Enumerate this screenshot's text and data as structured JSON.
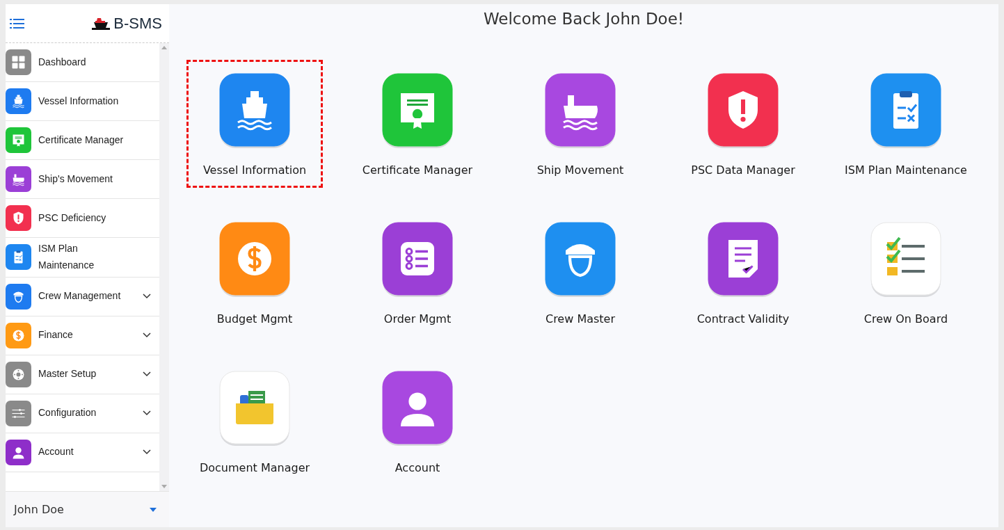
{
  "brand": {
    "name": "B-SMS"
  },
  "sidebar": {
    "items": [
      {
        "label": "Dashboard",
        "color": "#8a8a8a",
        "expandable": false
      },
      {
        "label": "Vessel Information",
        "color": "#1e7bf0",
        "expandable": false
      },
      {
        "label": "Certificate Manager",
        "color": "#1fc53a",
        "expandable": false
      },
      {
        "label": "Ship's Movement",
        "color": "#9b3fd6",
        "expandable": false
      },
      {
        "label": "PSC Deficiency",
        "color": "#f2304f",
        "expandable": false
      },
      {
        "label": "ISM Plan Maintenance",
        "color": "#1e86f0",
        "expandable": false
      },
      {
        "label": "Crew Management",
        "color": "#1e7bf0",
        "expandable": true
      },
      {
        "label": "Finance",
        "color": "#ff9a14",
        "expandable": true
      },
      {
        "label": "Master Setup",
        "color": "#8a8a8a",
        "expandable": true
      },
      {
        "label": "Configuration",
        "color": "#8a8a8a",
        "expandable": true
      },
      {
        "label": "Account",
        "color": "#8e2ec9",
        "expandable": true
      }
    ]
  },
  "user": {
    "name": "John Doe"
  },
  "main": {
    "title": "Welcome Back John Doe!",
    "tiles": [
      {
        "label": "Vessel Information",
        "color": "#1e86f0",
        "highlighted": true
      },
      {
        "label": "Certificate Manager",
        "color": "#1fc53a",
        "highlighted": false
      },
      {
        "label": "Ship Movement",
        "color": "#a848e0",
        "highlighted": false
      },
      {
        "label": "PSC Data Manager",
        "color": "#f2304f",
        "highlighted": false
      },
      {
        "label": "ISM Plan Maintenance",
        "color": "#1e90f0",
        "highlighted": false
      },
      {
        "label": "Budget Mgmt",
        "color": "#ff8a14",
        "highlighted": false
      },
      {
        "label": "Order Mgmt",
        "color": "#9b3fd6",
        "highlighted": false
      },
      {
        "label": "Crew Master",
        "color": "#1e8ff0",
        "highlighted": false
      },
      {
        "label": "Contract Validity",
        "color": "#9b3fd6",
        "highlighted": false
      },
      {
        "label": "Crew On Board",
        "color": "#ffffff",
        "highlighted": false
      },
      {
        "label": "Document Manager",
        "color": "#ffffff",
        "highlighted": false
      },
      {
        "label": "Account",
        "color": "#a848e0",
        "highlighted": false
      }
    ]
  }
}
